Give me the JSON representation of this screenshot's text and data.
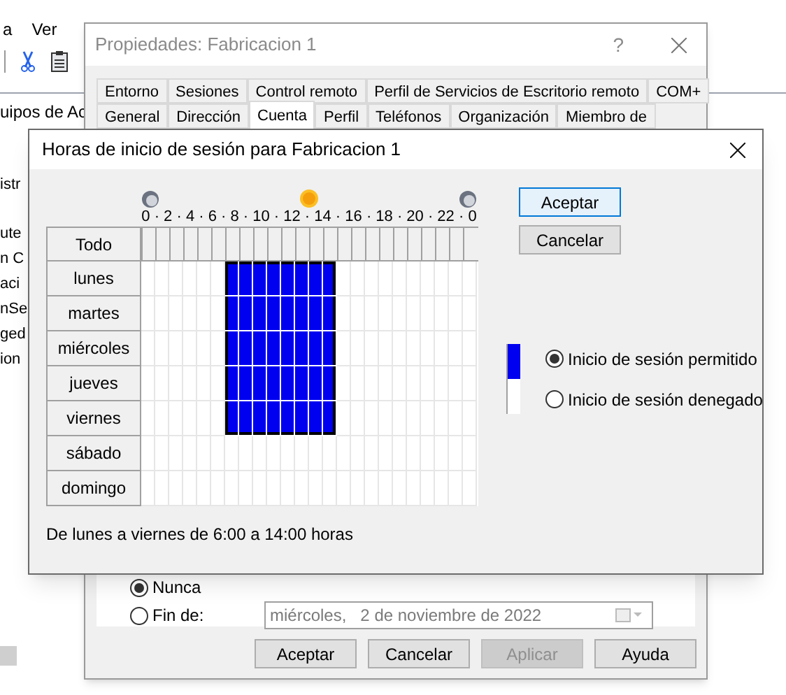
{
  "background_app": {
    "menu": [
      "a",
      "Ver"
    ],
    "tree_items": [
      "uipos de Ac",
      "istr",
      "ute",
      "n C",
      "aci",
      "nSe",
      "ged",
      "ion"
    ]
  },
  "properties_window": {
    "title": "Propiedades: Fabricacion 1",
    "help": "?",
    "tab_rows": [
      [
        {
          "label": "Entorno",
          "selected": false
        },
        {
          "label": "Sesiones",
          "selected": false
        },
        {
          "label": "Control remoto",
          "selected": false
        },
        {
          "label": "Perfil de Servicios de Escritorio remoto",
          "selected": false
        },
        {
          "label": "COM+",
          "selected": false
        }
      ],
      [
        {
          "label": "General",
          "selected": false
        },
        {
          "label": "Dirección",
          "selected": false
        },
        {
          "label": "Cuenta",
          "selected": true
        },
        {
          "label": "Perfil",
          "selected": false
        },
        {
          "label": "Teléfonos",
          "selected": false
        },
        {
          "label": "Organización",
          "selected": false
        },
        {
          "label": "Miembro de",
          "selected": false
        }
      ]
    ],
    "expiry_options": [
      {
        "label": "Nunca",
        "selected": true
      },
      {
        "label": "Fin de:",
        "selected": false
      }
    ],
    "expiry_date": {
      "value": "miércoles,   2 de noviembre de 2022",
      "disabled": true
    },
    "buttons": [
      {
        "label": "Aceptar",
        "disabled": false
      },
      {
        "label": "Cancelar",
        "disabled": false
      },
      {
        "label": "Aplicar",
        "disabled": true
      },
      {
        "label": "Ayuda",
        "disabled": false
      }
    ]
  },
  "logon_hours_dialog": {
    "title": "Horas de inicio de sesión para Fabricacion 1",
    "hour_scale": "0 · 2 · 4 · 6 · 8 · 10 · 12 · 14 · 16 · 18 · 20 · 22 · 0",
    "all_button": "Todo",
    "days": [
      {
        "label": "lunes",
        "permitted": [
          false,
          false,
          false,
          false,
          false,
          false,
          true,
          true,
          true,
          true,
          true,
          true,
          true,
          true,
          false,
          false,
          false,
          false,
          false,
          false,
          false,
          false,
          false,
          false
        ]
      },
      {
        "label": "martes",
        "permitted": [
          false,
          false,
          false,
          false,
          false,
          false,
          true,
          true,
          true,
          true,
          true,
          true,
          true,
          true,
          false,
          false,
          false,
          false,
          false,
          false,
          false,
          false,
          false,
          false
        ]
      },
      {
        "label": "miércoles",
        "permitted": [
          false,
          false,
          false,
          false,
          false,
          false,
          true,
          true,
          true,
          true,
          true,
          true,
          true,
          true,
          false,
          false,
          false,
          false,
          false,
          false,
          false,
          false,
          false,
          false
        ]
      },
      {
        "label": "jueves",
        "permitted": [
          false,
          false,
          false,
          false,
          false,
          false,
          true,
          true,
          true,
          true,
          true,
          true,
          true,
          true,
          false,
          false,
          false,
          false,
          false,
          false,
          false,
          false,
          false,
          false
        ]
      },
      {
        "label": "viernes",
        "permitted": [
          false,
          false,
          false,
          false,
          false,
          false,
          true,
          true,
          true,
          true,
          true,
          true,
          true,
          true,
          false,
          false,
          false,
          false,
          false,
          false,
          false,
          false,
          false,
          false
        ]
      },
      {
        "label": "sábado",
        "permitted": [
          false,
          false,
          false,
          false,
          false,
          false,
          false,
          false,
          false,
          false,
          false,
          false,
          false,
          false,
          false,
          false,
          false,
          false,
          false,
          false,
          false,
          false,
          false,
          false
        ]
      },
      {
        "label": "domingo",
        "permitted": [
          false,
          false,
          false,
          false,
          false,
          false,
          false,
          false,
          false,
          false,
          false,
          false,
          false,
          false,
          false,
          false,
          false,
          false,
          false,
          false,
          false,
          false,
          false,
          false
        ]
      }
    ],
    "summary": "De lunes a viernes de 6:00 a 14:00 horas",
    "buttons": [
      {
        "label": "Aceptar",
        "focused": true
      },
      {
        "label": "Cancelar",
        "focused": false
      }
    ],
    "modes": [
      {
        "label": "Inicio de sesión permitido",
        "selected": true
      },
      {
        "label": "Inicio de sesión denegado",
        "selected": false
      }
    ]
  }
}
